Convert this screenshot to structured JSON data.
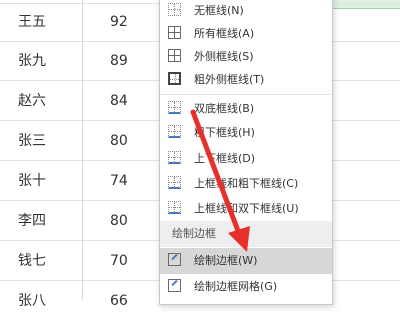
{
  "rows": [
    {
      "name": "王五",
      "score": "92"
    },
    {
      "name": "张九",
      "score": "89"
    },
    {
      "name": "赵六",
      "score": "84"
    },
    {
      "name": "张三",
      "score": "80"
    },
    {
      "name": "张十",
      "score": "74"
    },
    {
      "name": "李四",
      "score": "80"
    },
    {
      "name": "钱七",
      "score": "70"
    },
    {
      "name": "张八",
      "score": "66"
    }
  ],
  "menu": {
    "items": [
      {
        "label": "无框线(N)",
        "icon": "no-border-icon"
      },
      {
        "label": "所有框线(A)",
        "icon": "all-borders-icon"
      },
      {
        "label": "外侧框线(S)",
        "icon": "outside-borders-icon"
      },
      {
        "label": "粗外侧框线(T)",
        "icon": "thick-outside-borders-icon"
      },
      {
        "label": "双底框线(B)",
        "icon": "double-bottom-border-icon"
      },
      {
        "label": "粗下框线(H)",
        "icon": "thick-bottom-border-icon"
      },
      {
        "label": "上下框线(D)",
        "icon": "top-bottom-border-icon"
      },
      {
        "label": "上框线和粗下框线(C)",
        "icon": "top-thick-bottom-border-icon"
      },
      {
        "label": "上框线和双下框线(U)",
        "icon": "top-double-bottom-border-icon"
      }
    ],
    "section_title": "绘制边框",
    "draw_items": [
      {
        "label": "绘制边框(W)",
        "icon": "draw-border-icon"
      },
      {
        "label": "绘制边框网格(G)",
        "icon": "draw-border-grid-icon"
      }
    ]
  },
  "colors": {
    "highlight": "#d7d7d7",
    "arrow": "#e8302a",
    "selection_green": "#dff1e2"
  }
}
